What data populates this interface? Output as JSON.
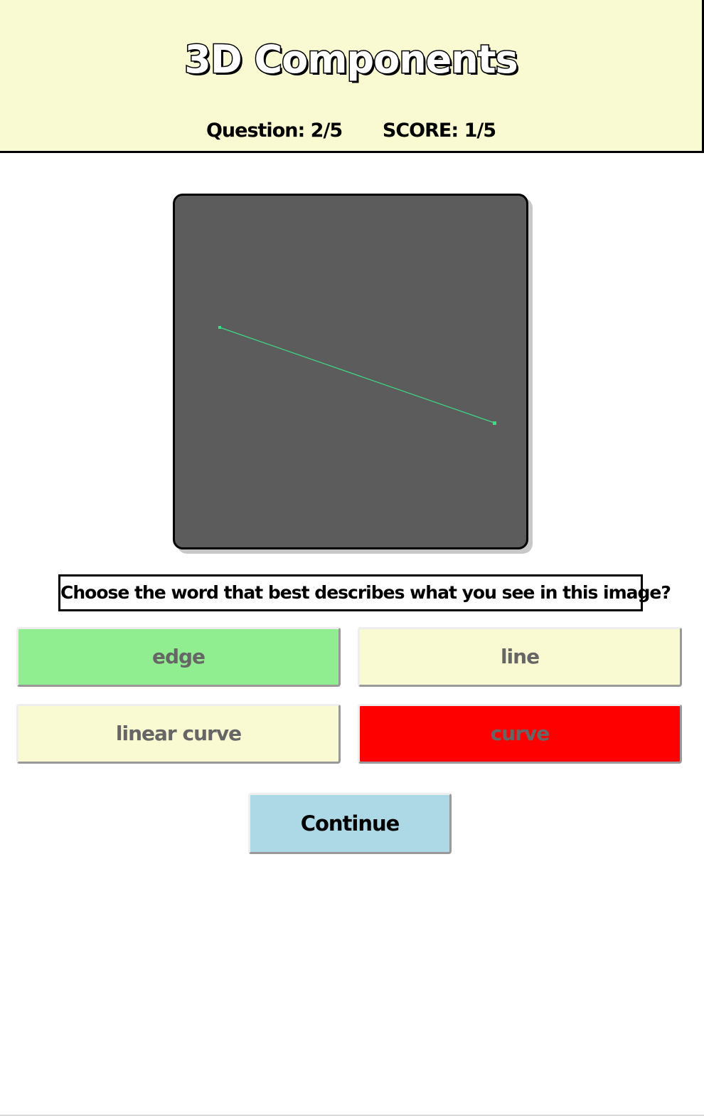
{
  "header": {
    "title": "3D Components",
    "question_label": "Question:",
    "question_value": "2/5",
    "score_label": "SCORE:",
    "score_value": "1/5"
  },
  "scene": {
    "background_color": "#5c5c5c",
    "line_color": "#3ddc84"
  },
  "prompt": {
    "text": "Choose the word that best describes what you see in this image?"
  },
  "answers": [
    {
      "label": "edge",
      "state": "correct",
      "color": "#90ee90"
    },
    {
      "label": "line",
      "state": "neutral",
      "color": "#fafad2"
    },
    {
      "label": "linear curve",
      "state": "neutral",
      "color": "#fafad2"
    },
    {
      "label": "curve",
      "state": "wrong",
      "color": "#ff0000"
    }
  ],
  "continue_button": {
    "label": "Continue",
    "color": "#add8e6"
  }
}
